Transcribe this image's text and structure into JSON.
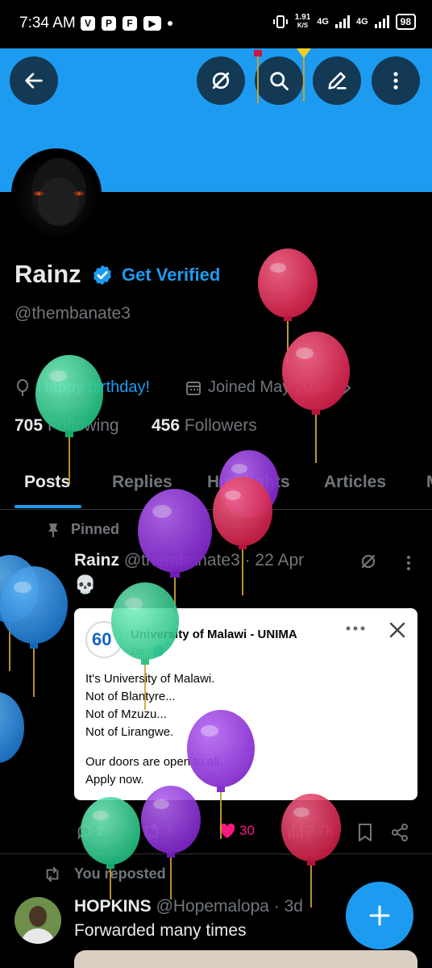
{
  "status_bar": {
    "time": "7:34 AM",
    "apps": [
      "V",
      "P",
      "F",
      "▶"
    ],
    "speed_value": "1.91",
    "speed_unit": "K/S",
    "network_1": "4G",
    "network_2": "4G",
    "battery": "98"
  },
  "header": {
    "back_icon": "arrow-left-icon",
    "grok_icon": "slashed-circle-icon",
    "search_icon": "search-icon",
    "edit_icon": "pencil-icon",
    "more_icon": "vertical-dots-icon"
  },
  "profile": {
    "name": "Rainz",
    "get_verified": "Get Verified",
    "handle": "@thembanate3",
    "birthday": "Happy birthday!",
    "joined": "Joined May 2022",
    "following_count": "705",
    "following_label": "Following",
    "followers_count": "456",
    "followers_label": "Followers"
  },
  "tabs": [
    "Posts",
    "Replies",
    "Highlights",
    "Articles",
    "M"
  ],
  "active_tab": "Posts",
  "pinned_post": {
    "pinned_label": "Pinned",
    "author": "Rainz",
    "handle_time": "@thembanate3 · 22 Apr",
    "text": "💀",
    "card": {
      "logo_text": "60",
      "title": "University of Malawi - UNIMA",
      "time": "2m · 🌐",
      "lines": [
        "It's University of Malawi.",
        "Not of Blantyre...",
        "Not of Mzuzu...",
        "Not of Lirangwe.",
        "",
        "Our doors are open to all.",
        "Apply now."
      ]
    },
    "replies": "2",
    "reposts": "7",
    "likes": "30",
    "views": "2.7K"
  },
  "reposted_post": {
    "reposted_label": "You reposted",
    "author": "HOPKINS",
    "handle_time": "@Hopemalopa · 3d",
    "text": "Forwarded many times"
  },
  "colors": {
    "accent": "#1d9bf0",
    "like": "#f91880",
    "balloon_green": "#2ecc8f",
    "balloon_red": "#d9264f",
    "balloon_purple": "#8e2bd6",
    "balloon_blue": "#1f7fd6"
  }
}
